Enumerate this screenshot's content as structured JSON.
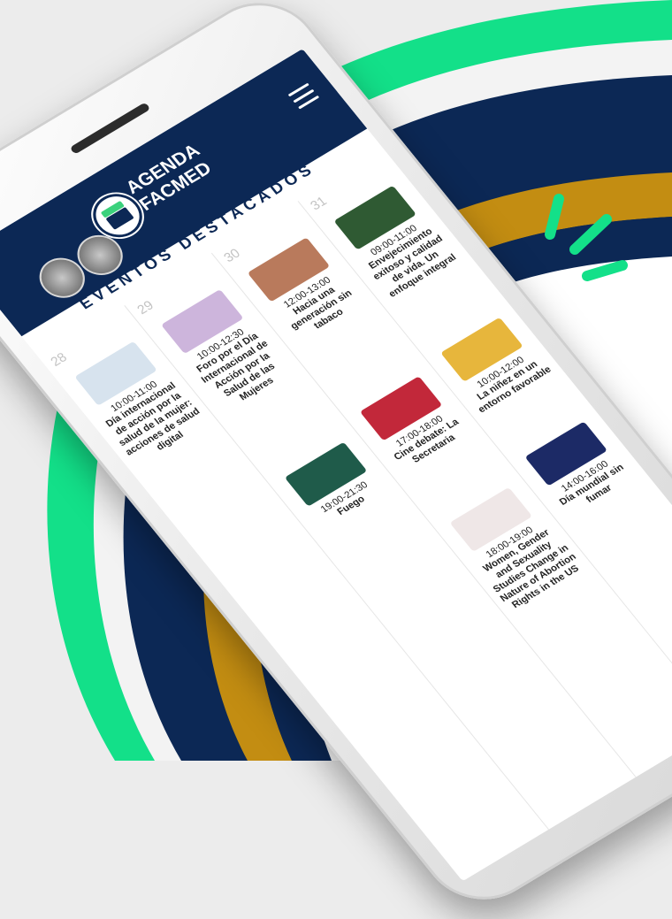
{
  "app": {
    "brand_line1": "AGENDA",
    "brand_line2": "FACMED",
    "section_title": "EVENTOS DESTACADOS"
  },
  "icons": {
    "menu": "hamburger-menu-icon",
    "calendar": "calendar-icon"
  },
  "colors": {
    "navy": "#0c2855",
    "green": "#13e089",
    "gold": "#c38d12",
    "white": "#ffffff"
  },
  "days": [
    {
      "day": "28",
      "events": [
        {
          "time": "10:00-11:00",
          "title": "Día internacional de acción por la salud de la mujer: acciones de salud digital",
          "thumb": "#d7e3ee"
        }
      ]
    },
    {
      "day": "29",
      "events": [
        {
          "time": "10:00-12:30",
          "title": "Foro por el Día Internacional de Acción por la Salud de las Mujeres",
          "thumb": "#cdb5dc"
        },
        {
          "time": "19:00-21:30",
          "title": "Fuego",
          "thumb": "#1f5b4a"
        }
      ]
    },
    {
      "day": "30",
      "events": [
        {
          "time": "12:00-13:00",
          "title": "Hacia una generación sin tabaco",
          "thumb": "#b97a5c"
        },
        {
          "time": "17:00-18:00",
          "title": "Cine debate: La Secretaria",
          "thumb": "#c2283a"
        },
        {
          "time": "18:00-19:00",
          "title": "Women, Gender and Sexuality Studies Change in Nature of Abortion Rights in the US",
          "thumb": "#efe7e7"
        }
      ]
    },
    {
      "day": "31",
      "events": [
        {
          "time": "09:00-11:00",
          "title": "Envejecimiento exitoso y calidad de vida. Un enfoque integral",
          "thumb": "#2f5a33"
        },
        {
          "time": "10:00-12:00",
          "title": "La niñez en un entorno favorable",
          "thumb": "#e7b63c"
        },
        {
          "time": "14:00-16:00",
          "title": "Día mundial sin fumar",
          "thumb": "#1c2a66"
        }
      ]
    }
  ]
}
